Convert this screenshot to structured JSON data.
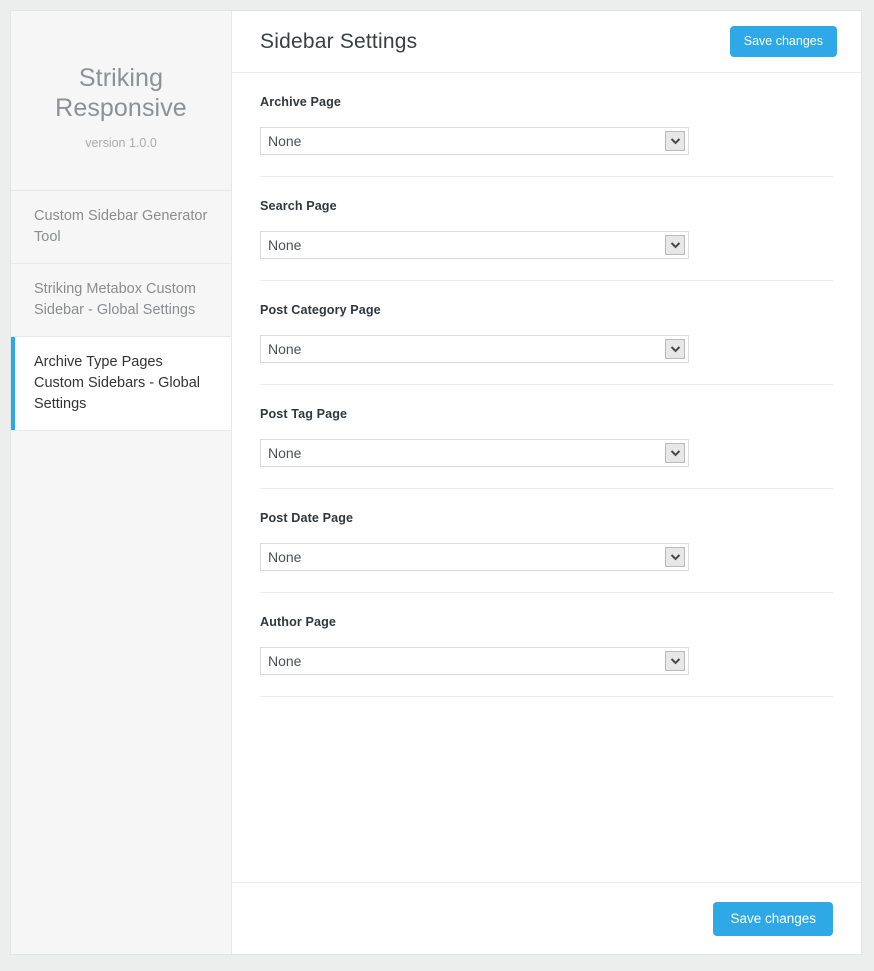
{
  "sidebar": {
    "brand": {
      "title": "Striking Responsive",
      "version": "version 1.0.0"
    },
    "items": [
      {
        "label": "Custom Sidebar Generator Tool",
        "active": false
      },
      {
        "label": "Striking Metabox Custom Sidebar - Global Settings",
        "active": false
      },
      {
        "label": "Archive Type Pages Custom Sidebars - Global Settings",
        "active": true
      }
    ]
  },
  "header": {
    "title": "Sidebar Settings",
    "save_label": "Save changes"
  },
  "footer": {
    "save_label": "Save changes"
  },
  "form": {
    "fields": [
      {
        "label": "Archive Page",
        "value": "None"
      },
      {
        "label": "Search Page",
        "value": "None"
      },
      {
        "label": "Post Category Page",
        "value": "None"
      },
      {
        "label": "Post Tag Page",
        "value": "None"
      },
      {
        "label": "Post Date Page",
        "value": "None"
      },
      {
        "label": "Author Page",
        "value": "None"
      }
    ]
  },
  "colors": {
    "accent": "#27a9e3",
    "button": "#2ea8e6",
    "page_background": "#eceded",
    "sidebar_background": "#f6f6f6"
  }
}
